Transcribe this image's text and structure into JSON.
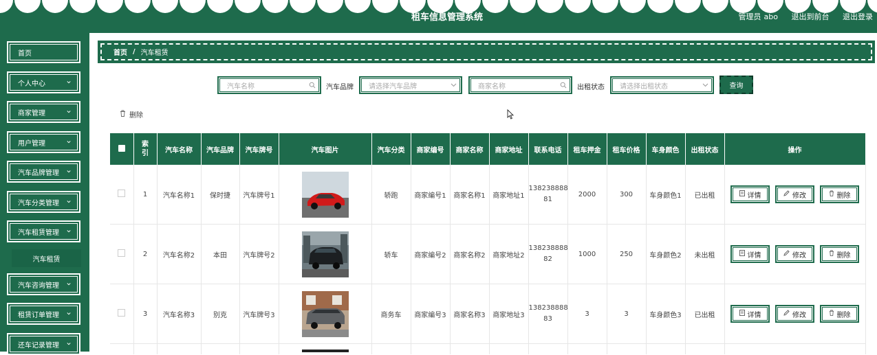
{
  "header": {
    "title": "租车信息管理系统",
    "role": "管理员",
    "user": "abo",
    "front_link": "退出到前台",
    "logout": "退出登录"
  },
  "sidebar": {
    "items": [
      {
        "label": "首页",
        "chevron": false
      },
      {
        "label": "个人中心",
        "chevron": true
      },
      {
        "label": "商家管理",
        "chevron": true
      },
      {
        "label": "用户管理",
        "chevron": true
      },
      {
        "label": "汽车品牌管理",
        "chevron": true
      },
      {
        "label": "汽车分类管理",
        "chevron": true
      },
      {
        "label": "汽车租赁管理",
        "chevron": true
      },
      {
        "label": "汽车咨询管理",
        "chevron": true
      },
      {
        "label": "租赁订单管理",
        "chevron": true
      },
      {
        "label": "还车记录管理",
        "chevron": true
      }
    ],
    "submenu": {
      "label": "汽车租赁"
    }
  },
  "breadcrumb": {
    "home": "首页",
    "separator": "/",
    "current": "汽车租赁"
  },
  "search": {
    "car_name_placeholder": "汽车名称",
    "brand_label": "汽车品牌",
    "brand_placeholder": "请选择汽车品牌",
    "merchant_name_placeholder": "商家名称",
    "status_label": "出租状态",
    "status_placeholder": "请选择出租状态",
    "query_button": "查询"
  },
  "toolbar": {
    "delete_label": "删除"
  },
  "table": {
    "headers": {
      "index": "索引",
      "name": "汽车名称",
      "brand": "汽车品牌",
      "plate": "汽车牌号",
      "photo": "汽车图片",
      "category": "汽车分类",
      "merchant_no": "商家编号",
      "merchant_name": "商家名称",
      "merchant_addr": "商家地址",
      "phone": "联系电话",
      "deposit": "租车押金",
      "price": "租车价格",
      "color": "车身颜色",
      "status": "出租状态",
      "actions": "操作"
    },
    "rows": [
      {
        "index": "1",
        "name": "汽车名称1",
        "brand": "保时捷",
        "plate": "汽车牌号1",
        "category": "轿跑",
        "merchant_no": "商家编号1",
        "merchant_name": "商家名称1",
        "merchant_addr": "商家地址1",
        "phone_a": "138238888",
        "phone_b": "81",
        "deposit": "2000",
        "price": "300",
        "color": "车身颜色1",
        "status": "已出租"
      },
      {
        "index": "2",
        "name": "汽车名称2",
        "brand": "本田",
        "plate": "汽车牌号2",
        "category": "轿车",
        "merchant_no": "商家编号2",
        "merchant_name": "商家名称2",
        "merchant_addr": "商家地址2",
        "phone_a": "138238888",
        "phone_b": "82",
        "deposit": "1000",
        "price": "250",
        "color": "车身颜色2",
        "status": "未出租"
      },
      {
        "index": "3",
        "name": "汽车名称3",
        "brand": "别克",
        "plate": "汽车牌号3",
        "category": "商务车",
        "merchant_no": "商家编号3",
        "merchant_name": "商家名称3",
        "merchant_addr": "商家地址3",
        "phone_a": "138238888",
        "phone_b": "83",
        "deposit": "3",
        "price": "3",
        "color": "车身颜色3",
        "status": "已出租"
      }
    ],
    "actions": {
      "detail": "详情",
      "edit": "修改",
      "remove": "删除"
    }
  },
  "colors": {
    "primary": "#1e6b4c",
    "border": "#e6e6e6"
  },
  "icons": [
    "search-icon",
    "chevron-down-icon",
    "trash-icon",
    "document-icon",
    "edit-icon",
    "cursor-icon"
  ]
}
